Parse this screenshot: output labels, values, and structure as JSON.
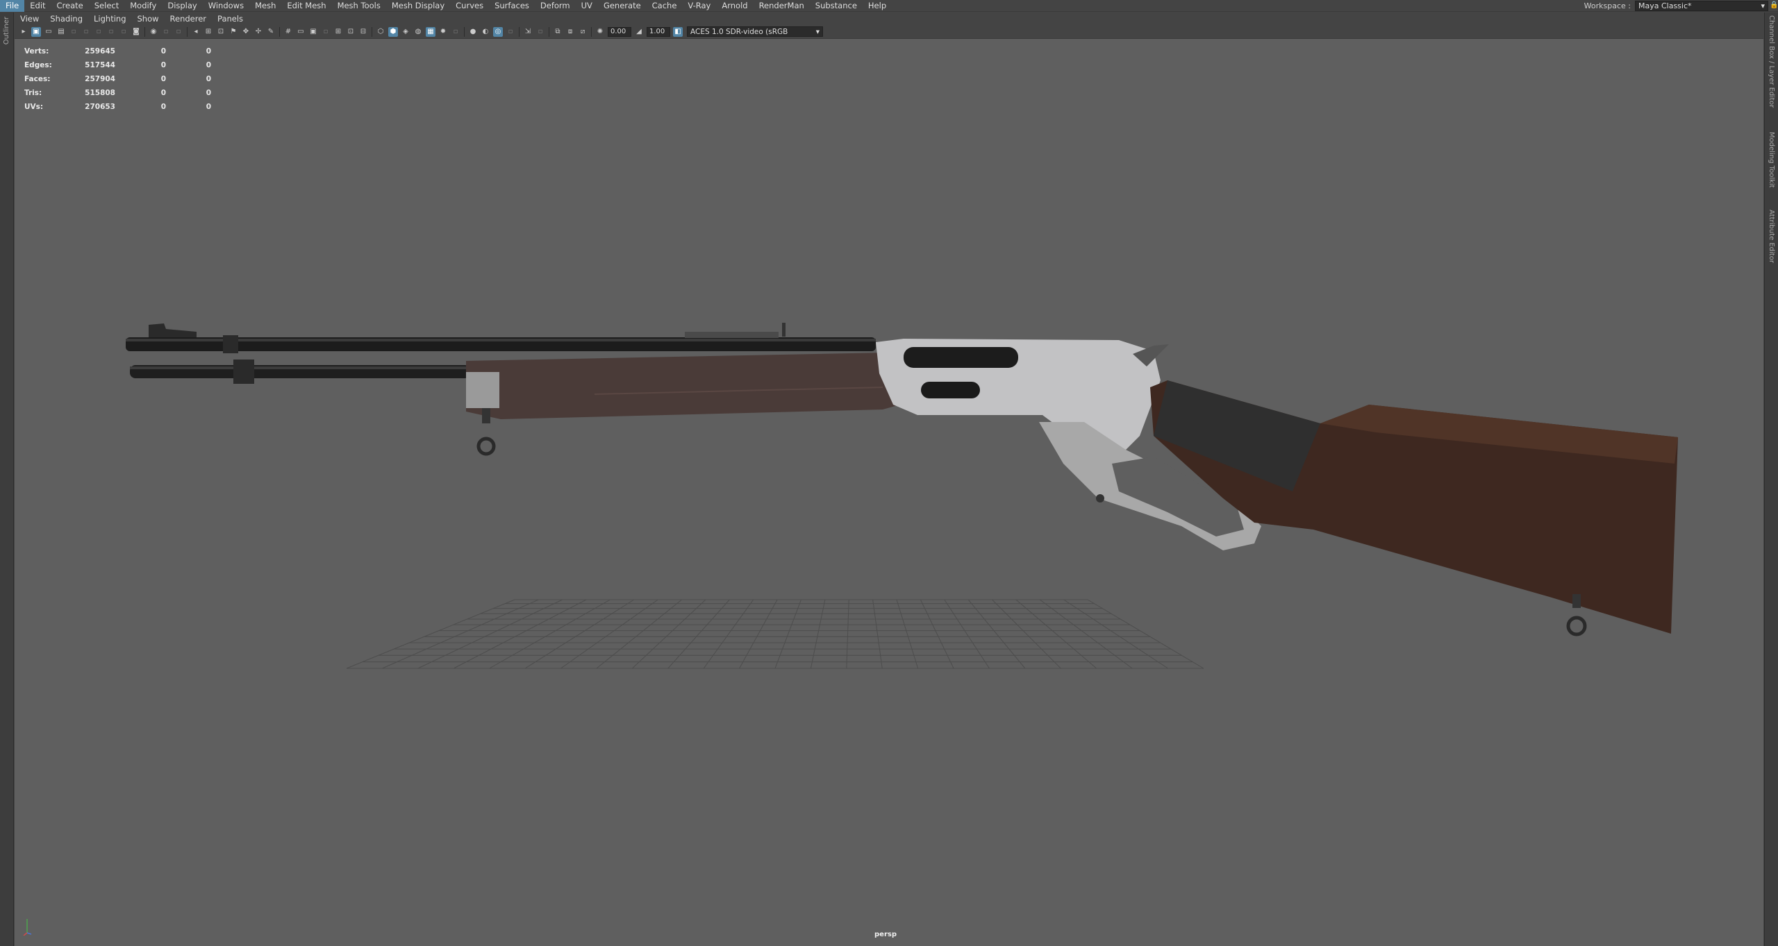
{
  "menubar": {
    "items": [
      "File",
      "Edit",
      "Create",
      "Select",
      "Modify",
      "Display",
      "Windows",
      "Mesh",
      "Edit Mesh",
      "Mesh Tools",
      "Mesh Display",
      "Curves",
      "Surfaces",
      "Deform",
      "UV",
      "Generate",
      "Cache",
      "V-Ray",
      "Arnold",
      "RenderMan",
      "Substance",
      "Help"
    ],
    "active": "File"
  },
  "workspace": {
    "label": "Workspace :",
    "value": "Maya Classic*"
  },
  "left_strip": {
    "label": "Outliner"
  },
  "right_strip": {
    "tabs": [
      "Channel Box / Layer Editor",
      "Modeling Toolkit",
      "Attribute Editor"
    ]
  },
  "panel_menu": [
    "View",
    "Shading",
    "Lighting",
    "Show",
    "Renderer",
    "Panels"
  ],
  "toolbar": {
    "exposure": "0.00",
    "gamma": "1.00",
    "color_transform": "ACES 1.0 SDR-video (sRGB"
  },
  "hud": {
    "rows": [
      {
        "label": "Verts:",
        "values": [
          "259645",
          "0",
          "0"
        ]
      },
      {
        "label": "Edges:",
        "values": [
          "517544",
          "0",
          "0"
        ]
      },
      {
        "label": "Faces:",
        "values": [
          "257904",
          "0",
          "0"
        ]
      },
      {
        "label": "Tris:",
        "values": [
          "515808",
          "0",
          "0"
        ]
      },
      {
        "label": "UVs:",
        "values": [
          "270653",
          "0",
          "0"
        ]
      }
    ]
  },
  "camera_label": "persp",
  "colors": {
    "accent": "#5285a6",
    "viewport": "#5f5f5f",
    "ui": "#444444",
    "wood": "#4a2f22",
    "metal": "#b8b8b8",
    "barrel": "#1e1e1e"
  }
}
